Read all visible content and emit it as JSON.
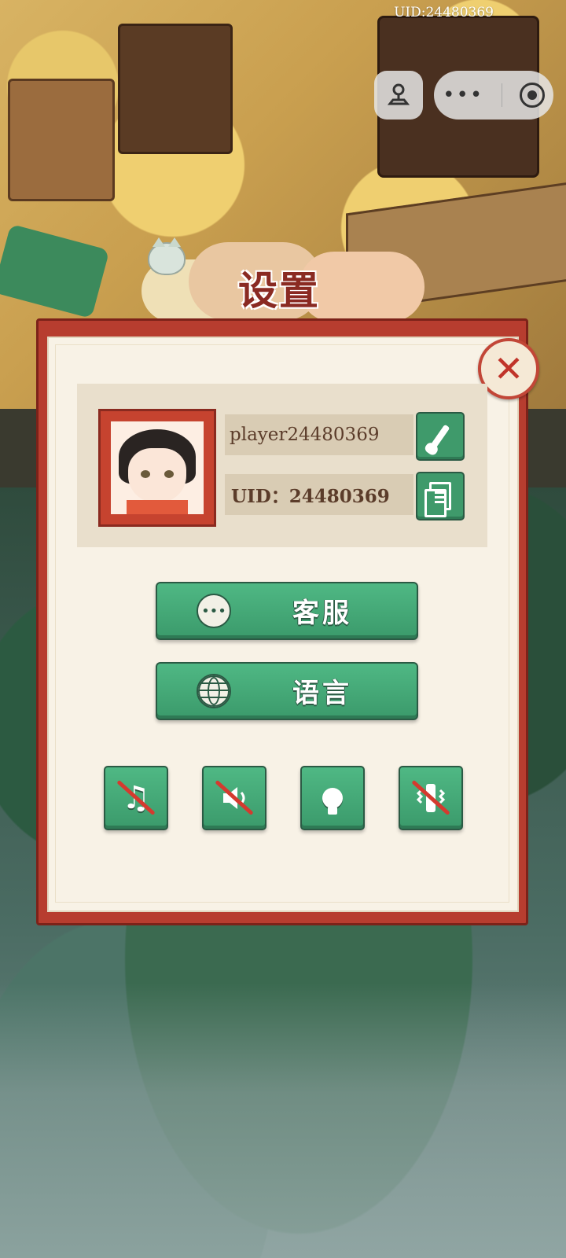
{
  "status": {
    "uid_text": "UID:24480369"
  },
  "capsule": {
    "more_icon": "more-dots-icon",
    "close_icon": "target-icon",
    "game_icon": "joystick-icon"
  },
  "dialog": {
    "title": "设置",
    "close_icon": "close-icon",
    "profile": {
      "name": "player24480369",
      "uid": "UID：24480369",
      "edit_icon": "brush-icon",
      "copy_icon": "copy-icon"
    },
    "buttons": {
      "service": {
        "label": "客服",
        "icon": "chat-bubble-icon"
      },
      "language": {
        "label": "语言",
        "icon": "globe-icon"
      }
    },
    "toggles": [
      {
        "name": "music",
        "icon": "music-note-icon",
        "disabled": true
      },
      {
        "name": "sound",
        "icon": "speaker-icon",
        "disabled": true
      },
      {
        "name": "hint",
        "icon": "light-bulb-icon",
        "disabled": false
      },
      {
        "name": "vibration",
        "icon": "vibration-icon",
        "disabled": true
      }
    ]
  },
  "colors": {
    "accent_green": "#3f9a6b",
    "frame_red": "#b73d2f",
    "paper": "#f8f2e6"
  }
}
